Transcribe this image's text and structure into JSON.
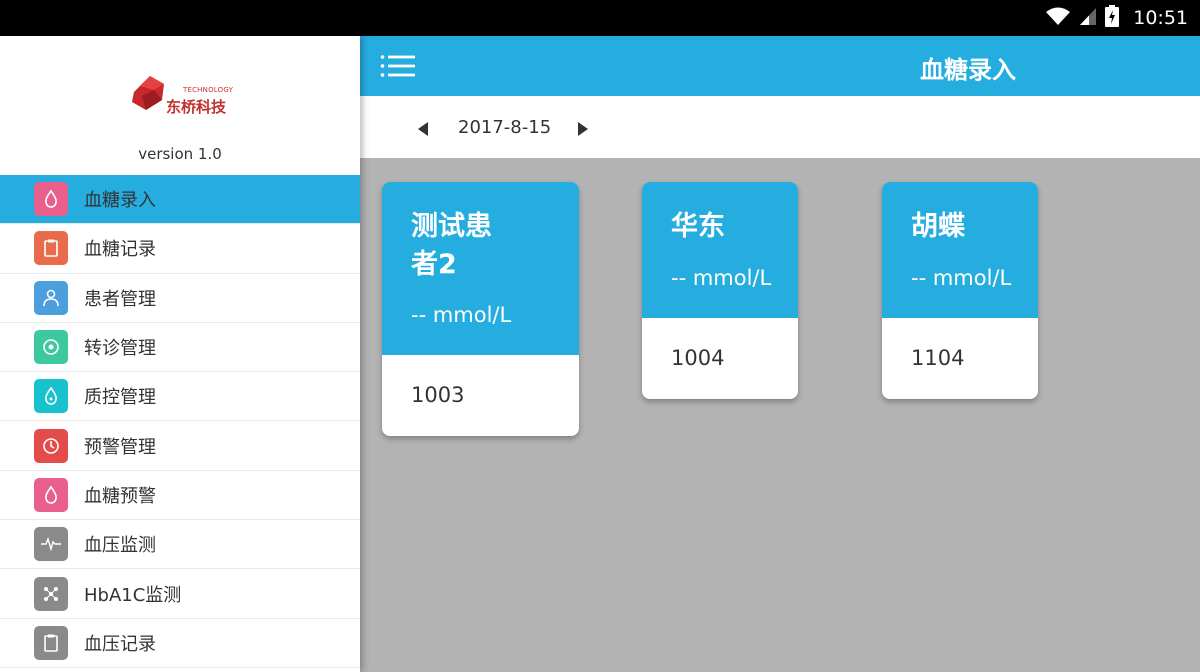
{
  "status_bar": {
    "time": "10:51",
    "icons": [
      "wifi-icon",
      "signal-icon",
      "battery-icon"
    ]
  },
  "sidebar": {
    "logo": {
      "tech_text": "TECHNOLOGY",
      "cn_text": "东桥科技"
    },
    "version": "version 1.0",
    "items": [
      {
        "label": "血糖录入",
        "icon": "blood-drop-icon",
        "color": "#e9608d",
        "active": true
      },
      {
        "label": "血糖记录",
        "icon": "clipboard-icon",
        "color": "#e86b4c"
      },
      {
        "label": "患者管理",
        "icon": "patient-icon",
        "color": "#4a9fdc"
      },
      {
        "label": "转诊管理",
        "icon": "referral-icon",
        "color": "#3ec8a0"
      },
      {
        "label": "质控管理",
        "icon": "quality-drop-icon",
        "color": "#17c2cc"
      },
      {
        "label": "预警管理",
        "icon": "clock-icon",
        "color": "#e44b4b"
      },
      {
        "label": "血糖预警",
        "icon": "blood-drop-icon",
        "color": "#e9608d"
      },
      {
        "label": "血压监测",
        "icon": "pulse-icon",
        "color": "#8a8a8a"
      },
      {
        "label": "HbA1C监测",
        "icon": "molecule-icon",
        "color": "#8a8a8a"
      },
      {
        "label": "血压记录",
        "icon": "clipboard-icon",
        "color": "#8a8a8a"
      }
    ]
  },
  "appbar": {
    "title": "血糖录入"
  },
  "datebar": {
    "date": "2017-8-15"
  },
  "cards": [
    {
      "name_line1": "测试患",
      "name_line2": "者2",
      "value": "-- mmol/L",
      "id": "1003"
    },
    {
      "name_line1": "华东",
      "value": "-- mmol/L",
      "id": "1004"
    },
    {
      "name_line1": "胡蝶",
      "value": "-- mmol/L",
      "id": "1104"
    }
  ],
  "colors": {
    "accent": "#25ade0",
    "background": "#b3b3b3"
  }
}
